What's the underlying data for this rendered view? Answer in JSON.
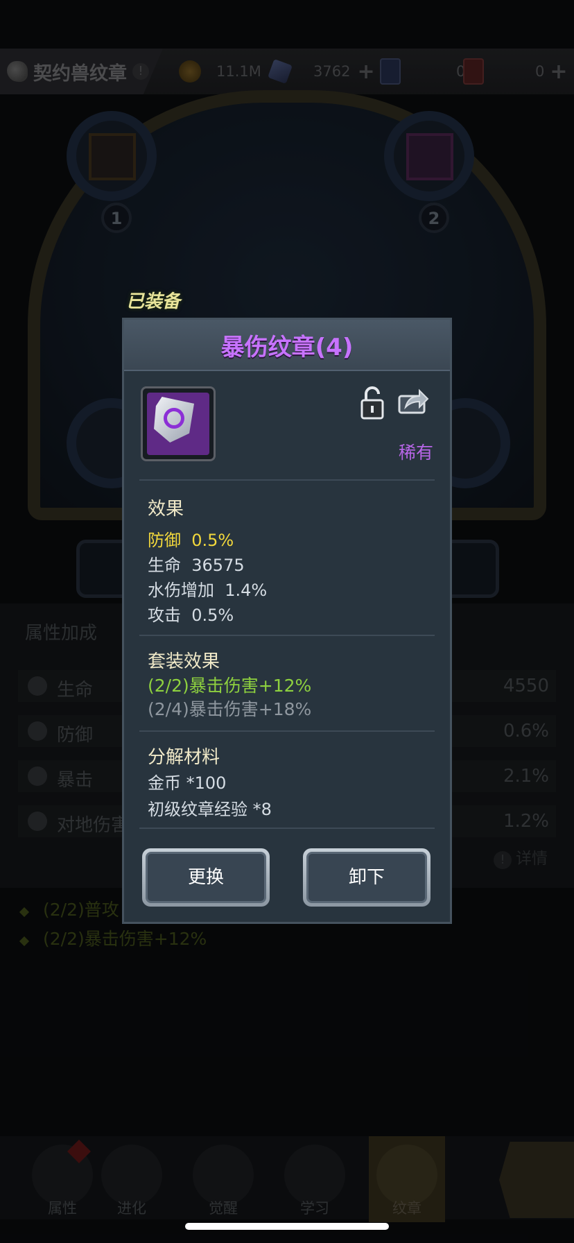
{
  "topbar": {
    "title": "契约兽纹章",
    "gold": "11.1M",
    "crystal": "3762",
    "card_blue": "0",
    "card_red": "0"
  },
  "background": {
    "slots": [
      "1",
      "2"
    ],
    "equipped_label": "已装备",
    "attr_title": "属性加成",
    "attrs": [
      {
        "label": "生命",
        "value": "4550"
      },
      {
        "label": "防御",
        "value": "0.6%"
      },
      {
        "label": "暴击",
        "value": "2.1%"
      },
      {
        "label": "对地伤害",
        "value": "1.2%"
      }
    ],
    "detail": "详情",
    "bonuses": [
      "(2/2)普攻",
      "(2/2)暴击伤害+12%"
    ]
  },
  "dialog": {
    "title": "暴伤纹章(4)",
    "rarity": "稀有",
    "effect_title": "效果",
    "effects": [
      {
        "label": "防御",
        "value": "0.5%"
      },
      {
        "label": "生命",
        "value": "36575"
      },
      {
        "label": "水伤增加",
        "value": "1.4%"
      },
      {
        "label": "攻击",
        "value": "0.5%"
      }
    ],
    "set_title": "套装效果",
    "set_active": "(2/2)暴击伤害+12%",
    "set_inactive": "(2/4)暴击伤害+18%",
    "decompose_title": "分解材料",
    "decompose": [
      "金币 *100",
      "初级纹章经验 *8"
    ],
    "btn_replace": "更换",
    "btn_unequip": "卸下"
  },
  "nav": {
    "items": [
      "属性",
      "进化",
      "觉醒",
      "学习",
      "纹章"
    ],
    "active": "纹章"
  },
  "colors": {
    "title_purple": "#c773ff",
    "rarity_purple": "#b866e8",
    "highlight_yellow": "#f2d83c",
    "set_green": "#8ed13f"
  }
}
